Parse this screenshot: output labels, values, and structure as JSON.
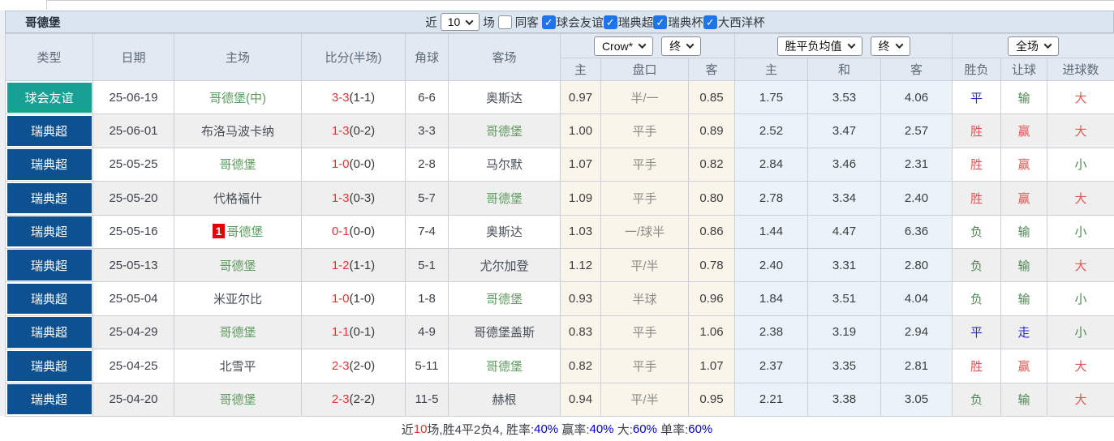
{
  "title": "哥德堡",
  "filter_bar": {
    "recent_label": "近",
    "recent_select_value": "10",
    "matches_label": "场",
    "same_venue": {
      "label": "同客",
      "checked": false
    },
    "leagues": [
      {
        "label": "球会友谊",
        "checked": true
      },
      {
        "label": "瑞典超",
        "checked": true
      },
      {
        "label": "瑞典杯",
        "checked": true
      },
      {
        "label": "大西洋杯",
        "checked": true
      }
    ]
  },
  "table": {
    "columns": [
      "类型",
      "日期",
      "主场",
      "比分(半场)",
      "角球",
      "客场"
    ],
    "odds_selects": {
      "book": "Crow*",
      "book_time": "终",
      "avg": "胜平负均值",
      "avg_time": "终",
      "scope": "全场"
    },
    "sub_columns": [
      "主",
      "盘口",
      "客",
      "主",
      "和",
      "客",
      "胜负",
      "让球",
      "进球数"
    ],
    "rows": [
      {
        "type": {
          "text": "球会友谊",
          "cls": "friendly"
        },
        "date": "25-06-19",
        "home": {
          "badge": "",
          "text": "哥德堡(中)",
          "cls": "focus"
        },
        "score": {
          "full": "3-3",
          "half": "(1-1)"
        },
        "corners": "6-6",
        "away": {
          "text": "奥斯达",
          "cls": ""
        },
        "odds_home": "0.97",
        "handicap": "半/一",
        "odds_away": "0.85",
        "avg_home": "1.75",
        "avg_draw": "3.53",
        "avg_away": "4.06",
        "res_wdl": {
          "text": "平",
          "cls": "blue"
        },
        "res_handicap": {
          "text": "输",
          "cls": "green"
        },
        "res_goals": {
          "text": "大",
          "cls": "red"
        }
      },
      {
        "type": {
          "text": "瑞典超",
          "cls": "league"
        },
        "date": "25-06-01",
        "home": {
          "badge": "",
          "text": "布洛马波卡纳",
          "cls": ""
        },
        "score": {
          "full": "1-3",
          "half": "(0-2)"
        },
        "corners": "3-3",
        "away": {
          "text": "哥德堡",
          "cls": "focus"
        },
        "odds_home": "1.00",
        "handicap": "平手",
        "odds_away": "0.89",
        "avg_home": "2.52",
        "avg_draw": "3.47",
        "avg_away": "2.57",
        "res_wdl": {
          "text": "胜",
          "cls": "red"
        },
        "res_handicap": {
          "text": "赢",
          "cls": "red"
        },
        "res_goals": {
          "text": "大",
          "cls": "red"
        }
      },
      {
        "type": {
          "text": "瑞典超",
          "cls": "league"
        },
        "date": "25-05-25",
        "home": {
          "badge": "",
          "text": "哥德堡",
          "cls": "focus"
        },
        "score": {
          "full": "1-0",
          "half": "(0-0)"
        },
        "corners": "2-8",
        "away": {
          "text": "马尔默",
          "cls": ""
        },
        "odds_home": "1.07",
        "handicap": "平手",
        "odds_away": "0.82",
        "avg_home": "2.84",
        "avg_draw": "3.46",
        "avg_away": "2.31",
        "res_wdl": {
          "text": "胜",
          "cls": "red"
        },
        "res_handicap": {
          "text": "赢",
          "cls": "red"
        },
        "res_goals": {
          "text": "小",
          "cls": "green"
        }
      },
      {
        "type": {
          "text": "瑞典超",
          "cls": "league"
        },
        "date": "25-05-20",
        "home": {
          "badge": "",
          "text": "代格福什",
          "cls": ""
        },
        "score": {
          "full": "1-3",
          "half": "(0-3)"
        },
        "corners": "5-7",
        "away": {
          "text": "哥德堡",
          "cls": "focus"
        },
        "odds_home": "1.09",
        "handicap": "平手",
        "odds_away": "0.80",
        "avg_home": "2.78",
        "avg_draw": "3.34",
        "avg_away": "2.40",
        "res_wdl": {
          "text": "胜",
          "cls": "red"
        },
        "res_handicap": {
          "text": "赢",
          "cls": "red"
        },
        "res_goals": {
          "text": "大",
          "cls": "red"
        }
      },
      {
        "type": {
          "text": "瑞典超",
          "cls": "league"
        },
        "date": "25-05-16",
        "home": {
          "badge": "1",
          "text": "哥德堡",
          "cls": "focus"
        },
        "score": {
          "full": "0-1",
          "half": "(0-0)"
        },
        "corners": "7-4",
        "away": {
          "text": "奥斯达",
          "cls": ""
        },
        "odds_home": "1.03",
        "handicap": "一/球半",
        "odds_away": "0.86",
        "avg_home": "1.44",
        "avg_draw": "4.47",
        "avg_away": "6.36",
        "res_wdl": {
          "text": "负",
          "cls": "green"
        },
        "res_handicap": {
          "text": "输",
          "cls": "green"
        },
        "res_goals": {
          "text": "小",
          "cls": "green"
        }
      },
      {
        "type": {
          "text": "瑞典超",
          "cls": "league"
        },
        "date": "25-05-13",
        "home": {
          "badge": "",
          "text": "哥德堡",
          "cls": "focus"
        },
        "score": {
          "full": "1-2",
          "half": "(1-1)"
        },
        "corners": "5-1",
        "away": {
          "text": "尤尔加登",
          "cls": ""
        },
        "odds_home": "1.12",
        "handicap": "平/半",
        "odds_away": "0.78",
        "avg_home": "2.40",
        "avg_draw": "3.31",
        "avg_away": "2.80",
        "res_wdl": {
          "text": "负",
          "cls": "green"
        },
        "res_handicap": {
          "text": "输",
          "cls": "green"
        },
        "res_goals": {
          "text": "大",
          "cls": "red"
        }
      },
      {
        "type": {
          "text": "瑞典超",
          "cls": "league"
        },
        "date": "25-05-04",
        "home": {
          "badge": "",
          "text": "米亚尔比",
          "cls": ""
        },
        "score": {
          "full": "1-0",
          "half": "(1-0)"
        },
        "corners": "1-8",
        "away": {
          "text": "哥德堡",
          "cls": "focus"
        },
        "odds_home": "0.93",
        "handicap": "半球",
        "odds_away": "0.96",
        "avg_home": "1.84",
        "avg_draw": "3.51",
        "avg_away": "4.04",
        "res_wdl": {
          "text": "负",
          "cls": "green"
        },
        "res_handicap": {
          "text": "输",
          "cls": "green"
        },
        "res_goals": {
          "text": "小",
          "cls": "green"
        }
      },
      {
        "type": {
          "text": "瑞典超",
          "cls": "league"
        },
        "date": "25-04-29",
        "home": {
          "badge": "",
          "text": "哥德堡",
          "cls": "focus"
        },
        "score": {
          "full": "1-1",
          "half": "(0-1)"
        },
        "corners": "4-9",
        "away": {
          "text": "哥德堡盖斯",
          "cls": ""
        },
        "odds_home": "0.83",
        "handicap": "平手",
        "odds_away": "1.06",
        "avg_home": "2.38",
        "avg_draw": "3.19",
        "avg_away": "2.94",
        "res_wdl": {
          "text": "平",
          "cls": "blue"
        },
        "res_handicap": {
          "text": "走",
          "cls": "blue"
        },
        "res_goals": {
          "text": "小",
          "cls": "green"
        }
      },
      {
        "type": {
          "text": "瑞典超",
          "cls": "league"
        },
        "date": "25-04-25",
        "home": {
          "badge": "",
          "text": "北雪平",
          "cls": ""
        },
        "score": {
          "full": "2-3",
          "half": "(2-0)"
        },
        "corners": "5-11",
        "away": {
          "text": "哥德堡",
          "cls": "focus"
        },
        "odds_home": "0.82",
        "handicap": "平手",
        "odds_away": "1.07",
        "avg_home": "2.37",
        "avg_draw": "3.35",
        "avg_away": "2.81",
        "res_wdl": {
          "text": "胜",
          "cls": "red"
        },
        "res_handicap": {
          "text": "赢",
          "cls": "red"
        },
        "res_goals": {
          "text": "大",
          "cls": "red"
        }
      },
      {
        "type": {
          "text": "瑞典超",
          "cls": "league"
        },
        "date": "25-04-20",
        "home": {
          "badge": "",
          "text": "哥德堡",
          "cls": "focus"
        },
        "score": {
          "full": "2-3",
          "half": "(2-2)"
        },
        "corners": "11-5",
        "away": {
          "text": "赫根",
          "cls": ""
        },
        "odds_home": "0.94",
        "handicap": "平/半",
        "odds_away": "0.95",
        "avg_home": "2.21",
        "avg_draw": "3.38",
        "avg_away": "3.05",
        "res_wdl": {
          "text": "负",
          "cls": "green"
        },
        "res_handicap": {
          "text": "输",
          "cls": "green"
        },
        "res_goals": {
          "text": "大",
          "cls": "red"
        }
      }
    ]
  },
  "summary": {
    "prefix": "近",
    "count": "10",
    "mid": "场,胜4平2负4, 胜率:",
    "win_rate": "40%",
    "seg2": " 赢率:",
    "handicap_rate": "40%",
    "seg3": " 大:",
    "big_rate": "60%",
    "seg4": " 单率:",
    "odd_rate": "60%"
  },
  "colors": {
    "type_friendly_teal": "#17a093",
    "type_league_navy": "#0e5191",
    "win_red": "#e45555",
    "lose_green": "#4e8755",
    "draw_blue": "#2e2ed0",
    "score_red": "#e63333",
    "focus_team_green": "#5f9c5f",
    "summary_link_blue": "#0000dd",
    "badge_red": "#e60000",
    "checkbox_blue": "#1e74e8",
    "bar_background": "#dbe5f0"
  }
}
